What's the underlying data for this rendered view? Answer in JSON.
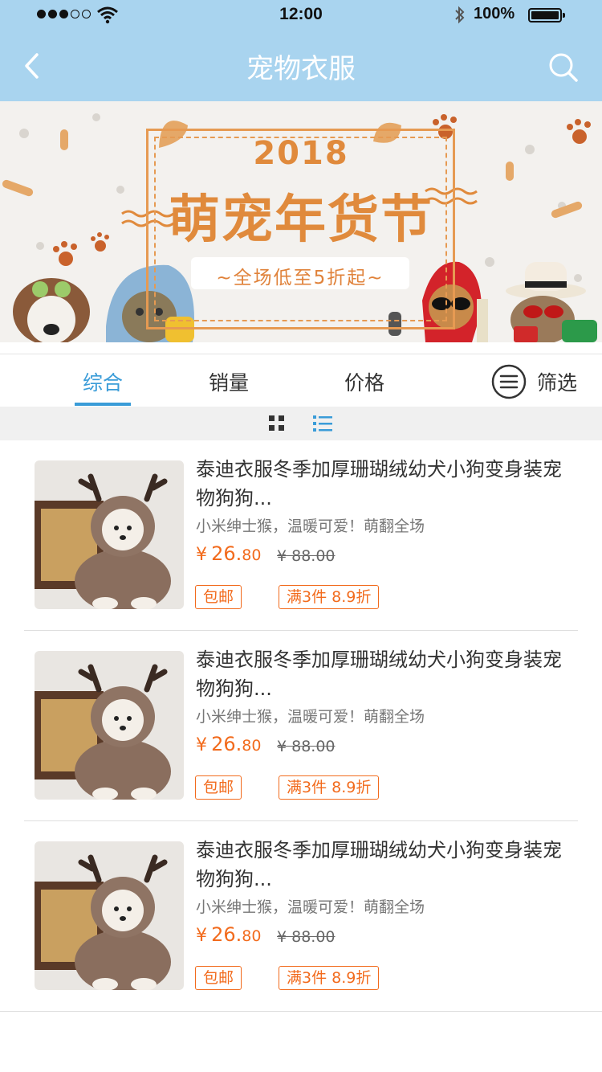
{
  "status_bar": {
    "time": "12:00",
    "battery": "100%"
  },
  "nav": {
    "title": "宠物衣服",
    "back_icon": "chevron-left-icon",
    "search_icon": "search-icon"
  },
  "banner": {
    "year": "2018",
    "title": "萌宠年货节",
    "subtitle": "~全场低至5折起~"
  },
  "tabs": {
    "items": [
      "综合",
      "销量",
      "价格"
    ],
    "active_index": 0,
    "filter_label": "筛选",
    "accent_color": "#3a9cd8"
  },
  "view_toggle": {
    "grid_icon": "grid-icon",
    "list_icon": "list-icon",
    "active": "list"
  },
  "products": [
    {
      "title": "泰迪衣服冬季加厚珊瑚绒幼犬小狗变身装宠物狗狗...",
      "desc": "小米绅士猴，温暖可爱！萌翻全场",
      "price_currency": "¥",
      "price_int": "26.",
      "price_dec": "80",
      "old_price": "¥ 88.00",
      "tag_free": "包邮",
      "tag_promo": "满3件 8.9折"
    },
    {
      "title": "泰迪衣服冬季加厚珊瑚绒幼犬小狗变身装宠物狗狗...",
      "desc": "小米绅士猴，温暖可爱！萌翻全场",
      "price_currency": "¥",
      "price_int": "26.",
      "price_dec": "80",
      "old_price": "¥ 88.00",
      "tag_free": "包邮",
      "tag_promo": "满3件 8.9折"
    },
    {
      "title": "泰迪衣服冬季加厚珊瑚绒幼犬小狗变身装宠物狗狗...",
      "desc": "小米绅士猴，温暖可爱！萌翻全场",
      "price_currency": "¥",
      "price_int": "26.",
      "price_dec": "80",
      "old_price": "¥ 88.00",
      "tag_free": "包邮",
      "tag_promo": "满3件 8.9折"
    }
  ],
  "colors": {
    "nav_bg": "#a9d4ef",
    "price": "#f26b1d",
    "banner_orange": "#e08a3c"
  }
}
